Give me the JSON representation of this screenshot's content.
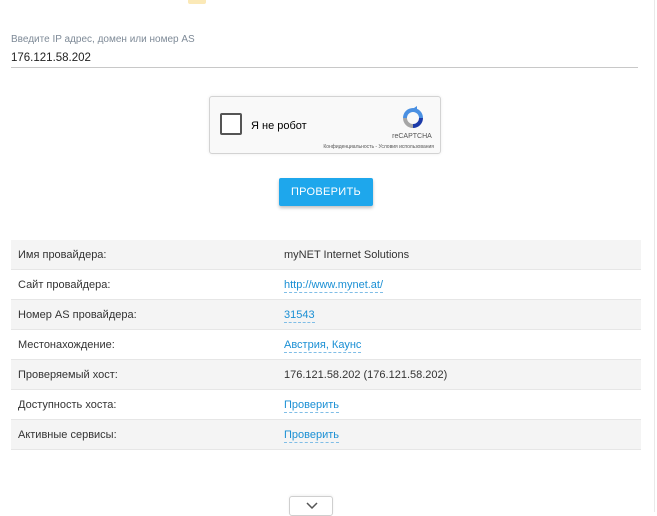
{
  "search": {
    "label": "Введите IP адрес, домен или номер AS",
    "value": "176.121.58.202"
  },
  "captcha": {
    "label": "Я не робот",
    "brand": "reCAPTCHA",
    "links": "Конфиденциальность - Условия использования"
  },
  "check_button": "ПРОВЕРИТЬ",
  "rows": [
    {
      "key": "Имя провайдера:",
      "value": "myNET Internet Solutions"
    },
    {
      "key": "Сайт провайдера:",
      "value": "http://www.mynet.at/"
    },
    {
      "key": "Номер AS провайдера:",
      "value": "31543"
    },
    {
      "key": "Местонахождение:",
      "value": "Австрия, Каунс"
    },
    {
      "key": "Проверяемый хост:",
      "value": "176.121.58.202 (176.121.58.202)"
    },
    {
      "key": "Доступность хоста:",
      "value": "Проверить"
    },
    {
      "key": "Активные сервисы:",
      "value": "Проверить"
    }
  ],
  "colors": {
    "accent": "#1ea7ec",
    "link": "#1a8fd4"
  }
}
